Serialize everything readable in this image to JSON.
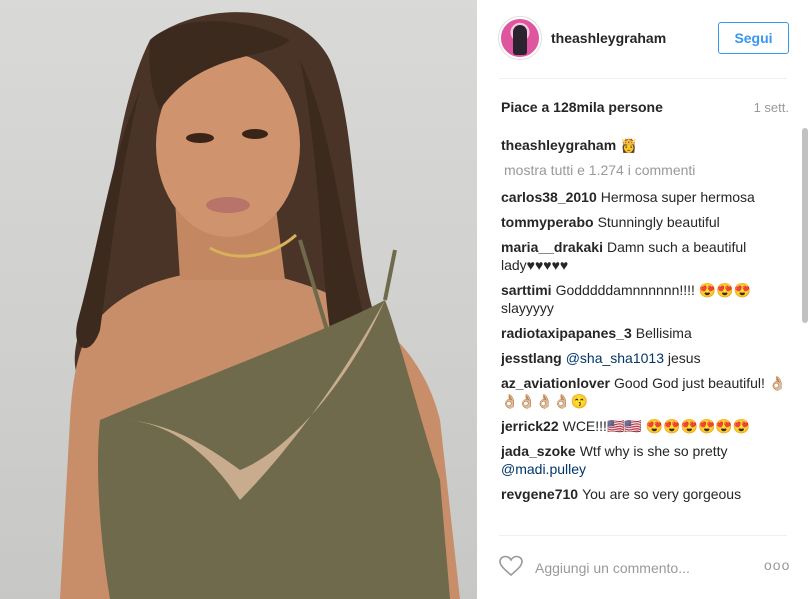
{
  "post": {
    "username": "theashleygraham",
    "follow_label": "Segui",
    "likes": "Piace a 128mila persone",
    "time_ago": "1 sett."
  },
  "comments": {
    "caption": {
      "user": "theashleygraham",
      "text": "👸"
    },
    "load_more": "mostra tutti e 1.274 i commenti",
    "items": [
      {
        "user": "carlos38_2010",
        "text": "Hermosa super hermosa"
      },
      {
        "user": "tommyperabo",
        "text": "Stunningly beautiful"
      },
      {
        "user": "maria__drakaki",
        "text": "Damn such a beautiful lady♥♥♥♥♥"
      },
      {
        "user": "sarttimi",
        "text": "Godddddamnnnnnn!!!! 😍😍😍 slayyyyy"
      },
      {
        "user": "radiotaxipapanes_3",
        "text": "Bellisima"
      },
      {
        "user": "jesstlang",
        "mention": "@sha_sha1013",
        "text": "jesus"
      },
      {
        "user": "az_aviationlover",
        "text": "Good God just beautiful! 👌🏼👌🏼👌🏼👌🏼👌🏼😙"
      },
      {
        "user": "jerrick22",
        "text": "WCE!!!🇺🇸🇺🇸 😍😍😍😍😍😍"
      },
      {
        "user": "jada_szoke",
        "text": "Wtf why is she so pretty",
        "mention": "@madi.pulley"
      },
      {
        "user": "revgene710",
        "text": "You are so very gorgeous"
      }
    ]
  },
  "footer": {
    "comment_placeholder": "Aggiungi un commento...",
    "more_label": "ooo"
  },
  "icons": {
    "like": "heart-icon",
    "options": "more-options-icon"
  },
  "colors": {
    "accent": "#3897f0",
    "muted": "#999999",
    "text": "#262626"
  }
}
